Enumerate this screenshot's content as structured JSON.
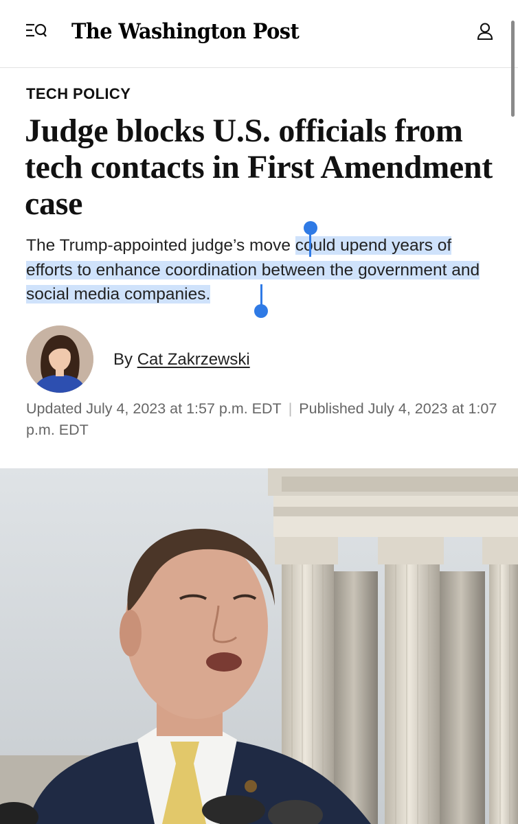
{
  "header": {
    "masthead": "The Washington Post",
    "menu_icon": "menu-search-icon",
    "account_icon": "user-icon"
  },
  "article": {
    "section": "TECH POLICY",
    "headline": "Judge blocks U.S. officials from tech contacts in First Amendment case",
    "dek_before": "The Trump-appointed judge’s move ",
    "dek_selected": "could upend years of efforts to enhance coordination between the government and social media companies.",
    "byline_prefix": "By ",
    "author": "Cat Zakrzewski",
    "updated": "Updated July 4, 2023 at 1:57 p.m. EDT",
    "separator": "|",
    "published": "Published July 4, 2023 at 1:07 p.m. EDT"
  },
  "colors": {
    "selection": "#cfe2fb",
    "selection_handle": "#2f7ae5",
    "meta_text": "#666666"
  }
}
